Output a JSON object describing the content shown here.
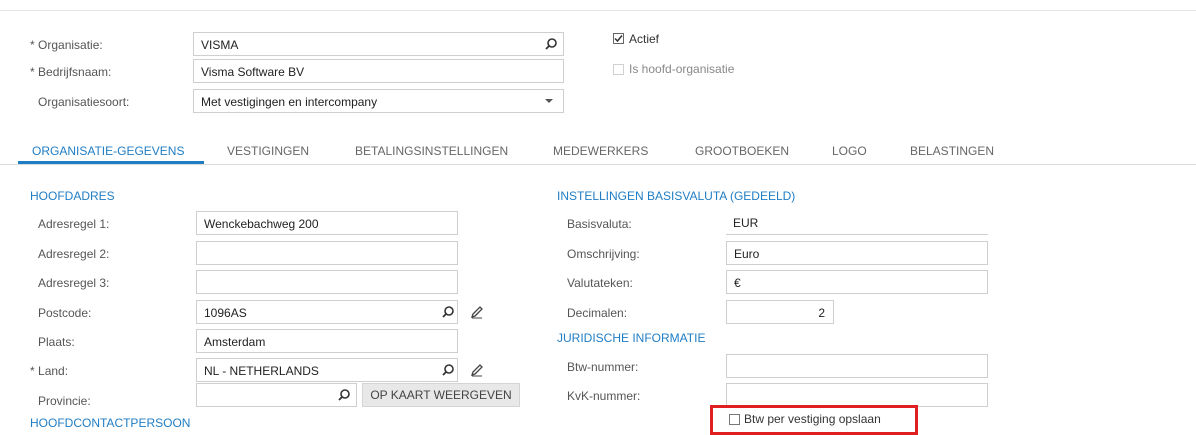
{
  "header": {
    "organisatie_label": "Organisatie:",
    "organisatie_value": "VISMA",
    "bedrijfsnaam_label": "Bedrijfsnaam:",
    "bedrijfsnaam_value": "Visma Software BV",
    "organisatiesoort_label": "Organisatiesoort:",
    "organisatiesoort_value": "Met vestigingen en intercompany",
    "actief_label": "Actief",
    "actief_checked": true,
    "hoofd_label": "Is hoofd-organisatie",
    "hoofd_checked": false
  },
  "tabs": [
    {
      "label": "ORGANISATIE-GEGEVENS",
      "active": true
    },
    {
      "label": "VESTIGINGEN"
    },
    {
      "label": "BETALINGSINSTELLINGEN"
    },
    {
      "label": "MEDEWERKERS"
    },
    {
      "label": "GROOTBOEKEN"
    },
    {
      "label": "LOGO"
    },
    {
      "label": "BELASTINGEN"
    }
  ],
  "address": {
    "section_title": "HOOFDADRES",
    "adresregel1_label": "Adresregel 1:",
    "adresregel1_value": "Wenckebachweg 200",
    "adresregel2_label": "Adresregel 2:",
    "adresregel2_value": "",
    "adresregel3_label": "Adresregel 3:",
    "adresregel3_value": "",
    "postcode_label": "Postcode:",
    "postcode_value": "1096AS",
    "plaats_label": "Plaats:",
    "plaats_value": "Amsterdam",
    "land_label": "Land:",
    "land_value": "NL - NETHERLANDS",
    "provincie_label": "Provincie:",
    "provincie_value": "",
    "map_button": "OP KAART WEERGEVEN",
    "contact_section_title": "HOOFDCONTACTPERSOON"
  },
  "currency": {
    "section_title": "INSTELLINGEN BASISVALUTA (GEDEELD)",
    "basisvaluta_label": "Basisvaluta:",
    "basisvaluta_value": "EUR",
    "omschrijving_label": "Omschrijving:",
    "omschrijving_value": "Euro",
    "valutateken_label": "Valutateken:",
    "valutateken_value": "€",
    "decimalen_label": "Decimalen:",
    "decimalen_value": "2"
  },
  "legal": {
    "section_title": "JURIDISCHE INFORMATIE",
    "btw_label": "Btw-nummer:",
    "btw_value": "",
    "kvk_label": "KvK-nummer:",
    "kvk_value": "",
    "btw_vestiging_label": "Btw per vestiging opslaan",
    "btw_vestiging_checked": false
  },
  "colors": {
    "accent": "#1f7dc4",
    "highlight": "#e02020"
  },
  "icons": {
    "search": "search-icon",
    "edit": "pencil-icon",
    "dropdown": "chevron-down-icon",
    "checkbox": "checkbox-icon"
  }
}
